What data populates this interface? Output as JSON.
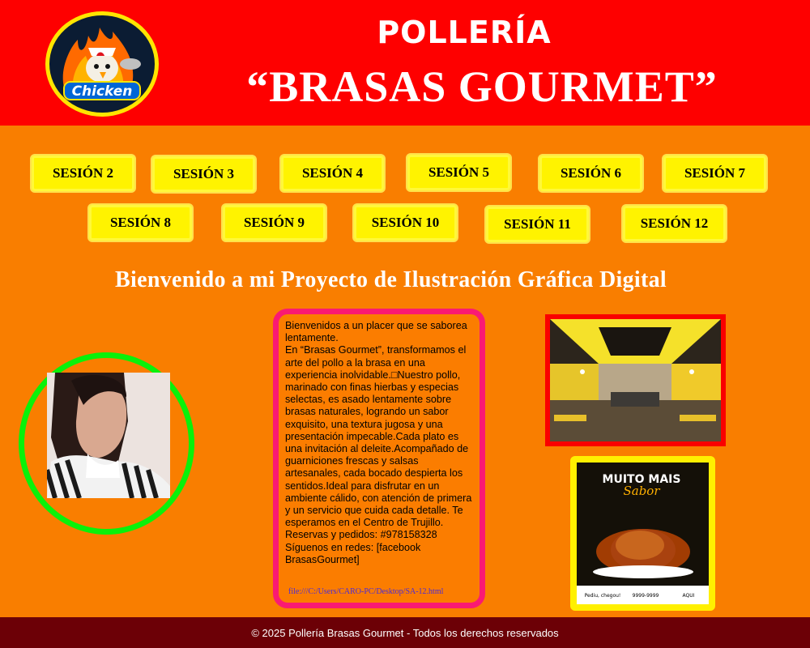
{
  "header": {
    "logo_text": "Chicken",
    "title_line1": "POLLERÍA",
    "title_line2": "“BRASAS GOURMET”"
  },
  "nav": {
    "buttons": [
      "SESIÓN 2",
      "SESIÓN 3",
      "SESIÓN 4",
      "SESIÓN 5",
      "SESIÓN 6",
      "SESIÓN 7",
      "SESIÓN 8",
      "SESIÓN 9",
      "SESIÓN 10",
      "SESIÓN 11",
      "SESIÓN 12"
    ]
  },
  "welcome": "Bienvenido a mi Proyecto de Ilustración Gráfica Digital",
  "intro_text": "Bienvenidos a un placer que se saborea lentamente.\nEn “Brasas Gourmet”, transformamos el arte del pollo a la brasa en una experiencia inolvidable.□Nuestro pollo, marinado con finas hierbas y especias selectas, es asado lentamente sobre brasas naturales, logrando un sabor exquisito, una textura jugosa y una presentación impecable.Cada plato es una invitación al deleite.Acompañado de guarniciones frescas y salsas artesanales, cada bocado despierta los sentidos.Ideal para disfrutar en un ambiente cálido, con atención de primera y un servicio que cuida cada detalle. Te esperamos en el Centro de Trujillo.\n Reservas y pedidos: #978158328\nSíguenos en redes: [facebook BrasasGourmet]",
  "file_link": "file:///C:/Users/CARO-PC/Desktop/SA-12.html",
  "poster": {
    "headline_1": "MUITO MAIS",
    "headline_2": "Sabor",
    "footer_1": "Pediu, chegou!",
    "footer_2": "9999-9999",
    "footer_3": "AQUI"
  },
  "footer": "© 2025 Pollería Brasas Gourmet - Todos los derechos reservados",
  "colors": {
    "header_bg": "#fe0000",
    "page_bg": "#f97e00",
    "button_bg": "#fff300",
    "avatar_ring": "#0af10a",
    "text_box_border": "#fa1a73",
    "footer_bg": "#6c0006"
  }
}
